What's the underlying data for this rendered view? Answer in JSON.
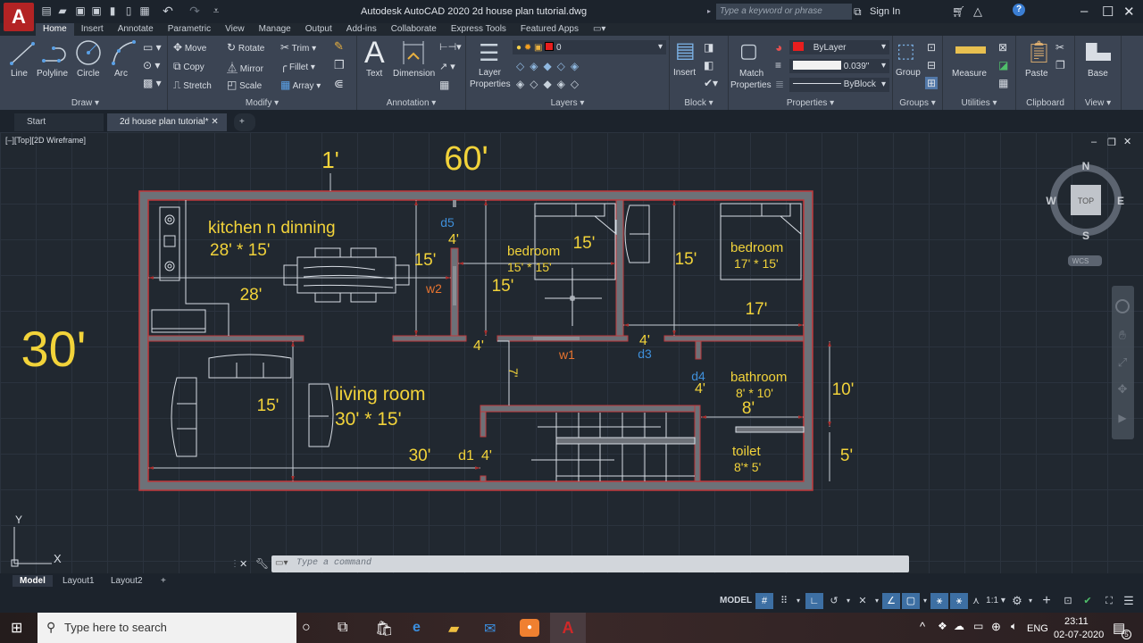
{
  "titlebar": {
    "app_letter": "A",
    "title": "Autodesk AutoCAD 2020    2d house plan tutorial.dwg",
    "search_placeholder": "Type a keyword or phrase",
    "sign_in": "Sign In",
    "minimize": "–",
    "maximize": "☐",
    "close": "✕"
  },
  "ribbon_tabs": [
    "Home",
    "Insert",
    "Annotate",
    "Parametric",
    "View",
    "Manage",
    "Output",
    "Add-ins",
    "Collaborate",
    "Express Tools",
    "Featured Apps"
  ],
  "ribbon": {
    "draw": {
      "label": "Draw ▾",
      "line": "Line",
      "polyline": "Polyline",
      "circle": "Circle",
      "arc": "Arc"
    },
    "modify": {
      "label": "Modify ▾",
      "move": "Move",
      "rotate": "Rotate",
      "trim": "Trim",
      "copy": "Copy",
      "mirror": "Mirror",
      "fillet": "Fillet",
      "stretch": "Stretch",
      "scale": "Scale",
      "array": "Array"
    },
    "annotation": {
      "label": "Annotation ▾",
      "text": "Text",
      "dimension": "Dimension"
    },
    "layers": {
      "label": "Layers ▾",
      "layer_properties_1": "Layer",
      "layer_properties_2": "Properties",
      "current_layer": "0",
      "layer_color": "#e81e1e"
    },
    "block": {
      "label": "Block ▾",
      "insert": "Insert"
    },
    "properties": {
      "label": "Properties ▾",
      "match_1": "Match",
      "match_2": "Properties",
      "color": "ByLayer",
      "color_swatch": "#e81e1e",
      "lineweight": "0.039\"",
      "linetype": "ByBlock"
    },
    "groups": {
      "label": "Groups ▾",
      "group": "Group"
    },
    "utilities": {
      "label": "Utilities ▾",
      "measure": "Measure"
    },
    "clipboard": {
      "label": "Clipboard",
      "paste": "Paste"
    },
    "view": {
      "label": "View ▾",
      "base": "Base"
    }
  },
  "file_tabs": {
    "start": "Start",
    "active": "2d house plan tutorial*",
    "close": "✕",
    "add": "+"
  },
  "viewport": {
    "label": "[–][Top][2D Wireframe]",
    "viewcube": {
      "n": "N",
      "s": "S",
      "e": "E",
      "w": "W",
      "face": "TOP",
      "wcs": "WCS"
    },
    "ucs": {
      "x": "X",
      "y": "Y"
    }
  },
  "drawing": {
    "overall_width": "60'",
    "overall_height": "30'",
    "wall_thickness": "1'",
    "rooms": [
      {
        "name": "kitchen n dinning",
        "size": "28' * 15'"
      },
      {
        "name": "bedroom",
        "size": "15' * 15'"
      },
      {
        "name": "bedroom",
        "size": "17' * 15'"
      },
      {
        "name": "living room",
        "size": "30' * 15'"
      },
      {
        "name": "bathroom",
        "size": "8' * 10'"
      },
      {
        "name": "toilet",
        "size": "8'* 5'"
      }
    ],
    "dims": {
      "kitchen_w": "28'",
      "kitchen_h": "15'",
      "bed1_h": "15'",
      "bed1_w": "15'",
      "bed2_h": "15'",
      "bed2_w": "17'",
      "living_h": "15'",
      "living_w": "30'",
      "bath_w": "8'",
      "bath_h": "10'",
      "toilet_h": "5'",
      "d5": "4'",
      "corr1": "4'",
      "corr2": "4'",
      "d4": "4'",
      "d1": "4'",
      "passage": "7'"
    },
    "tags": {
      "d5": "d5",
      "w2": "w2",
      "w1": "w1",
      "d3": "d3",
      "d4": "d4",
      "d1": "d1"
    }
  },
  "command_line": {
    "placeholder": "Type a command"
  },
  "layout_tabs": [
    "Model",
    "Layout1",
    "Layout2",
    "+"
  ],
  "status_bar": {
    "model": "MODEL",
    "scale": "1:1 ▾"
  },
  "taskbar": {
    "search_placeholder": "Type here to search",
    "language": "ENG",
    "time": "23:11",
    "date": "02-07-2020",
    "notifications": "5"
  },
  "colors": {
    "wall_fill": "#6d7178",
    "wall_outline": "#c0393b",
    "dim_text": "#f2d33a",
    "tag_blue": "#3f8fd9",
    "tag_orange": "#e8742f",
    "furniture": "#d8dde4"
  }
}
